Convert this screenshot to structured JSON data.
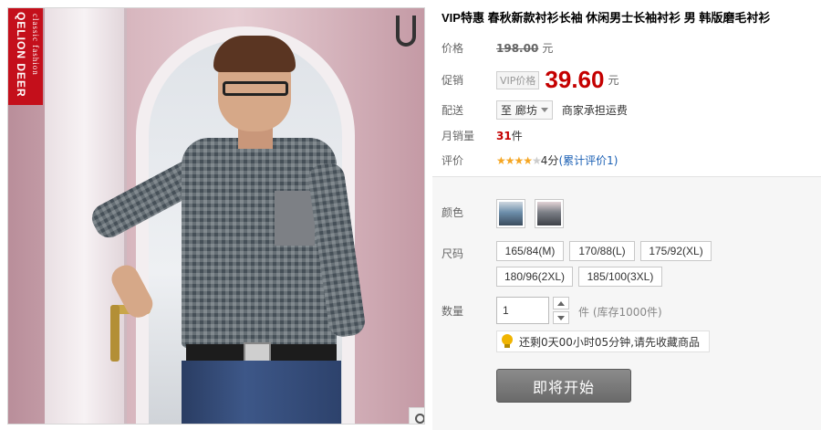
{
  "product": {
    "title": "VIP特惠 春秋新款衬衫长袖 休闲男士长袖衬衫 男 韩版磨毛衬衫",
    "brand_name": "QELION DEER",
    "brand_tagline": "classic fashion"
  },
  "price": {
    "label": "价格",
    "original": "198.00",
    "unit": "元"
  },
  "promo": {
    "label": "促销",
    "tag": "VIP价格",
    "price": "39.60",
    "unit": "元"
  },
  "shipping": {
    "label": "配送",
    "destination": "至 廊坊",
    "note": "商家承担运费"
  },
  "sales": {
    "label": "月销量",
    "count": "31",
    "unit": "件"
  },
  "rating": {
    "label": "评价",
    "stars_filled": "★★★★",
    "stars_empty": "★",
    "score": "4分",
    "reviews": "(累计评价1)"
  },
  "sku": {
    "color_label": "颜色",
    "size_label": "尺码",
    "sizes": [
      "165/84(M)",
      "170/88(L)",
      "175/92(XL)",
      "180/96(2XL)",
      "185/100(3XL)"
    ],
    "qty_label": "数量",
    "qty_value": "1",
    "stock_text": "件 (库存1000件)"
  },
  "tip": {
    "text": "还剩0天00小时05分钟,请先收藏商品"
  },
  "action": {
    "buy_label": "即将开始"
  },
  "colors": {
    "price_red": "#c40000",
    "brand_red": "#c40f1b",
    "star": "#f5a623",
    "link": "#1a5fb4"
  }
}
